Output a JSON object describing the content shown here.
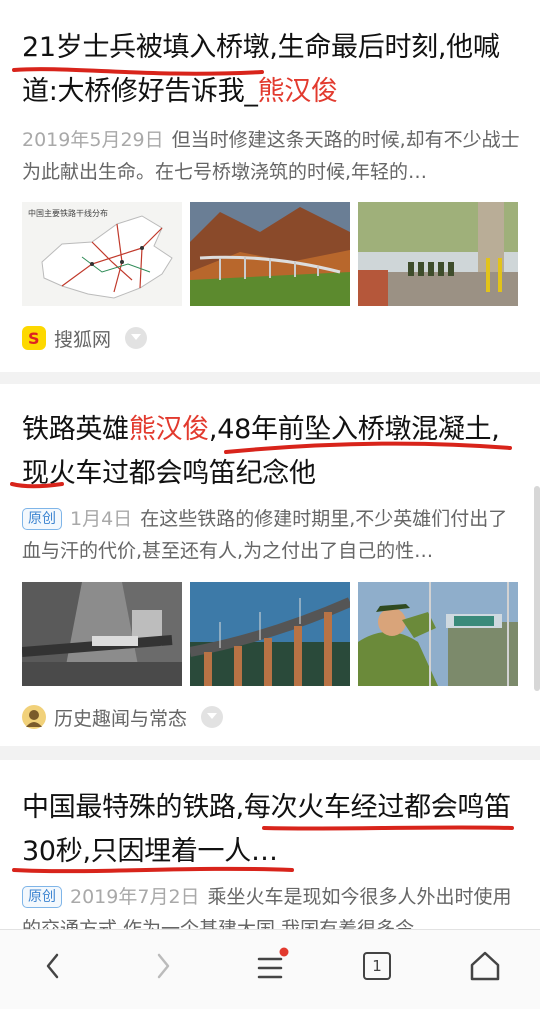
{
  "feed": [
    {
      "title_parts": [
        "21岁士兵被填入桥墩,生命最后时刻,他喊道:大桥修好告诉我_",
        "熊汉俊"
      ],
      "date": "2019年5月29日",
      "snippet": "但当时修建这条天路的时候,却有不少战士为此献出生命。在七号桥墩浇筑的时候,年轻的…",
      "map_caption": "中国主要铁路干线分布",
      "source": "搜狐网",
      "source_icon": "sohu-logo-icon"
    },
    {
      "title_parts": [
        "铁路英雄",
        "熊汉俊",
        ",48年前坠入桥墩混凝土,现火车过都会鸣笛纪念他"
      ],
      "badge": "原创",
      "date": "1月4日",
      "snippet": "在这些铁路的修建时期里,不少英雄们付出了血与汗的代价,甚至还有人,为之付出了自己的性…",
      "source": "历史趣闻与常态",
      "source_icon": "avatar-icon"
    },
    {
      "title_parts": [
        "中国最特殊的铁路,每次火车经过都会鸣笛30秒,只因埋着一人…"
      ],
      "badge": "原创",
      "date": "2019年7月2日",
      "snippet": "乘坐火车是现如今很多人外出时使用的交通方式,作为一个基建大国,我国有着很多令…"
    }
  ],
  "navbar": {
    "back_icon": "chevron-left-icon",
    "forward_icon": "chevron-right-icon",
    "menu_icon": "menu-icon",
    "tabs_count": "1",
    "home_icon": "home-icon",
    "accent_color": "#e23a2e"
  }
}
